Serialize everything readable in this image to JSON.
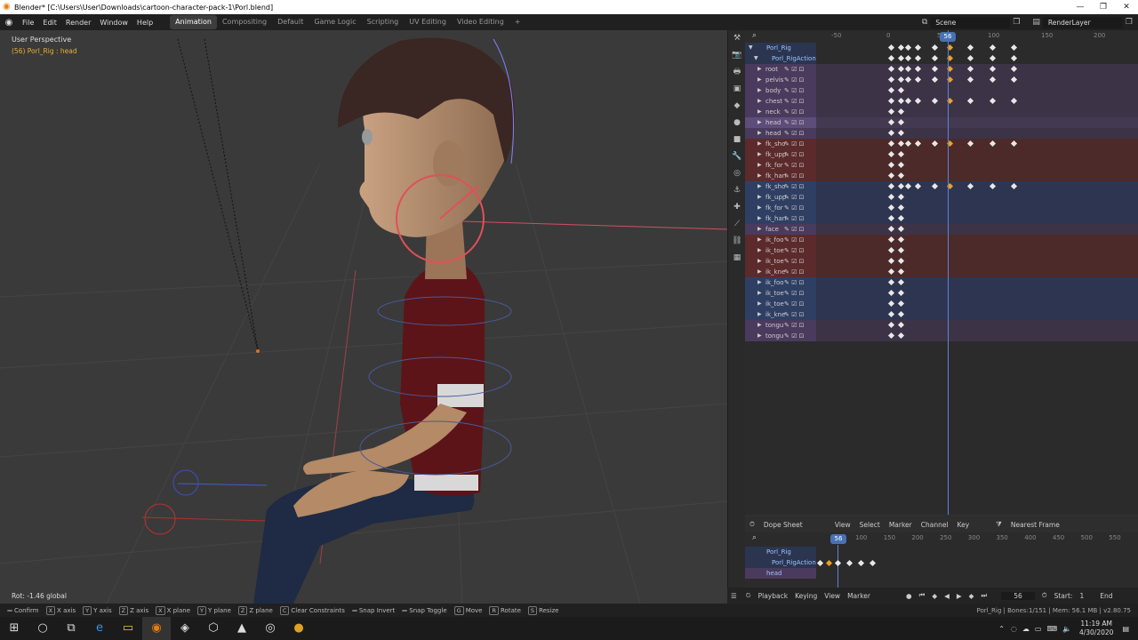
{
  "window": {
    "title": "Blender* [C:\\Users\\User\\Downloads\\cartoon-character-pack-1\\Porl.blend]"
  },
  "menu": {
    "items": [
      "File",
      "Edit",
      "Render",
      "Window",
      "Help"
    ],
    "workspaces": [
      "Animation",
      "Compositing",
      "Default",
      "Game Logic",
      "Scripting",
      "UV Editing",
      "Video Editing"
    ],
    "active_workspace": "Animation",
    "add_tab": "+",
    "scene": "Scene",
    "render_layer": "RenderLayer"
  },
  "viewport": {
    "view_name": "User Perspective",
    "object_info": "(56) Porl_Rig : head",
    "rotation_readout": "Rot: -1.46 global",
    "colors": {
      "bg": "#3a3a3a",
      "info": "#e8b030"
    }
  },
  "dopesheet": {
    "ruler_ticks": [
      "-50",
      "0",
      "50",
      "100",
      "150",
      "200"
    ],
    "current_frame": "56",
    "channels": [
      {
        "label": "Porl_Rig",
        "kind": "object"
      },
      {
        "label": "Porl_RigAction",
        "kind": "action"
      },
      {
        "label": "root",
        "kind": "purple"
      },
      {
        "label": "pelvis",
        "kind": "purple"
      },
      {
        "label": "body",
        "kind": "purple"
      },
      {
        "label": "chest",
        "kind": "purple"
      },
      {
        "label": "neck",
        "kind": "purple"
      },
      {
        "label": "head",
        "kind": "purple-sel"
      },
      {
        "label": "head",
        "kind": "purple"
      },
      {
        "label": "fk_sho",
        "kind": "red"
      },
      {
        "label": "fk_upp",
        "kind": "red"
      },
      {
        "label": "fk_for",
        "kind": "red"
      },
      {
        "label": "fk_han",
        "kind": "red"
      },
      {
        "label": "fk_sho",
        "kind": "blue"
      },
      {
        "label": "fk_upp",
        "kind": "blue"
      },
      {
        "label": "fk_for",
        "kind": "blue"
      },
      {
        "label": "fk_han",
        "kind": "blue"
      },
      {
        "label": "face",
        "kind": "purple"
      },
      {
        "label": "ik_foo",
        "kind": "red"
      },
      {
        "label": "ik_toe",
        "kind": "red"
      },
      {
        "label": "ik_toe",
        "kind": "red"
      },
      {
        "label": "ik_kne",
        "kind": "red"
      },
      {
        "label": "ik_foo",
        "kind": "blue"
      },
      {
        "label": "ik_toe",
        "kind": "blue"
      },
      {
        "label": "ik_toe",
        "kind": "blue"
      },
      {
        "label": "ik_kne",
        "kind": "blue"
      },
      {
        "label": "tongu",
        "kind": "purple"
      },
      {
        "label": "tongu",
        "kind": "purple"
      }
    ],
    "header": {
      "editor": "Dope Sheet",
      "menus": [
        "View",
        "Select",
        "Marker",
        "Channel",
        "Key"
      ],
      "snapping": "Nearest Frame"
    }
  },
  "timeline": {
    "ruler_ticks": [
      "100",
      "150",
      "200",
      "250",
      "300",
      "350",
      "400",
      "450",
      "500",
      "550"
    ],
    "current_frame": "56",
    "channels": [
      "Porl_Rig",
      "Porl_RigAction",
      "head"
    ]
  },
  "playback": {
    "menus": [
      "Playback",
      "Keying",
      "View",
      "Marker"
    ],
    "frame": "56",
    "start_label": "Start:",
    "start_value": "1",
    "end_label": "End"
  },
  "statusbar": {
    "hints": [
      {
        "key": "",
        "label": "Confirm"
      },
      {
        "key": "X",
        "label": "X axis"
      },
      {
        "key": "Y",
        "label": "Y axis"
      },
      {
        "key": "Z",
        "label": "Z axis"
      },
      {
        "key": "X",
        "label": "X plane"
      },
      {
        "key": "Y",
        "label": "Y plane"
      },
      {
        "key": "Z",
        "label": "Z plane"
      },
      {
        "key": "C",
        "label": "Clear Constraints"
      },
      {
        "key": "",
        "label": "Snap Invert"
      },
      {
        "key": "",
        "label": "Snap Toggle"
      },
      {
        "key": "G",
        "label": "Move"
      },
      {
        "key": "R",
        "label": "Rotate"
      },
      {
        "key": "S",
        "label": "Resize"
      }
    ],
    "info": "Porl_Rig | Bones:1/151 | Mem: 56.1 MB | v2.80.75"
  },
  "taskbar": {
    "time": "11:19 AM",
    "date": "4/30/2020"
  }
}
